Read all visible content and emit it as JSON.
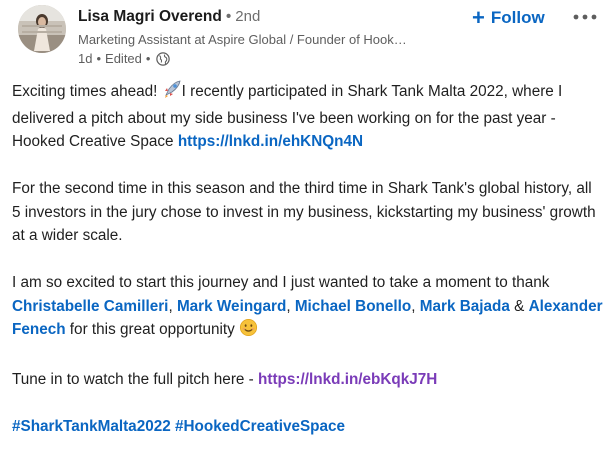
{
  "author": {
    "name": "Lisa Magri Overend",
    "separator": "•",
    "degree": "2nd",
    "headline": "Marketing Assistant at Aspire Global / Founder of Hook…",
    "time": "1d",
    "edited": "Edited",
    "visibility_icon": "globe-icon"
  },
  "actions": {
    "follow_label": "Follow",
    "follow_icon": "plus-icon",
    "more_icon": "ellipsis-icon"
  },
  "post": {
    "p1_text_a": "Exciting times ahead! ",
    "p1_emoji": "rocket-emoji",
    "p1_text_b": "I recently participated in Shark Tank Malta 2022, where I delivered a pitch about my side business I've been working on for the past year - Hooked Creative Space ",
    "p1_link": "https://lnkd.in/ehKNQn4N",
    "p2_text": "For the second time in this season and the third time in Shark Tank's global history, all 5 investors in the jury chose to invest in my business, kickstarting my business' growth at a wider scale.",
    "p3_text_a": "I am so excited to start this journey and I just wanted to take a moment to thank ",
    "mentions": [
      "Christabelle Camilleri",
      "Mark Weingard",
      "Michael Bonello",
      "Mark Bajada",
      "Alexander Fenech"
    ],
    "comma": ", ",
    "ampersand": " & ",
    "p3_text_b": " for this great opportunity ",
    "p3_emoji": "smiling-emoji",
    "p4_text": "Tune in to watch the full pitch here - ",
    "p4_link": "https://lnkd.in/ebKqkJ7H",
    "hashtags": [
      "#SharkTankMalta2022",
      "#HookedCreativeSpace"
    ]
  },
  "colors": {
    "link": "#0a66c2",
    "visited_link": "#7a3bb8",
    "text": "#1f1f1f",
    "muted": "#5e5e5e"
  }
}
